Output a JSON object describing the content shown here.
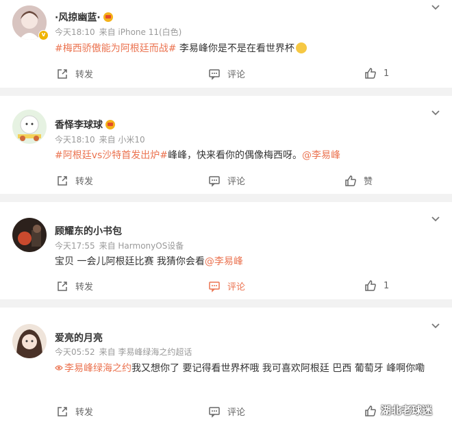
{
  "comments": [
    {
      "username": "·风掠幽蓝·",
      "time": "今天18:10",
      "source": "来自 iPhone 11(白色)",
      "tag": "#梅西骄傲能为阿根廷而战#",
      "text": " 李易峰你是不是在看世界杯",
      "mention": "",
      "actions": {
        "repost": "转发",
        "comment": "评论",
        "like": "1"
      },
      "colors": {
        "avatar": "#d9c2b8"
      }
    },
    {
      "username": "香怿李球球",
      "time": "今天18:10",
      "source": "来自 小米10",
      "tag": "#阿根廷vs沙特首发出炉#",
      "text": "峰峰，快来看你的偶像梅西呀。",
      "mention": "@李易峰",
      "actions": {
        "repost": "转发",
        "comment": "评论",
        "like": "赞"
      },
      "colors": {
        "avatar": "#dfeedd"
      }
    },
    {
      "username": "顾耀东的小书包",
      "time": "今天17:55",
      "source": "来自 HarmonyOS设备",
      "tag": "",
      "text": "宝贝 一会儿阿根廷比赛 我猜你会看",
      "mention": "@李易峰",
      "actions": {
        "repost": "转发",
        "comment": "评论",
        "like": "1"
      },
      "colors": {
        "avatar": "#3a2a24"
      }
    },
    {
      "username": "爱亮的月亮",
      "time": "今天05:52",
      "source": "来自 李易峰绿海之约超话",
      "tag": "李易峰绿海之约",
      "text": "我又想你了 要记得看世界杯哦 我可喜欢阿根廷 巴西 葡萄牙 峰啊你嘞",
      "mention": "",
      "actions": {
        "repost": "转发",
        "comment": "评论",
        "like": ""
      },
      "colors": {
        "avatar": "#e8dcd0"
      }
    }
  ],
  "watermark": "湖北老球迷",
  "colors": {
    "accent": "#eb7350",
    "background": "#f2f2f2",
    "card": "#ffffff",
    "meta": "#999999"
  }
}
